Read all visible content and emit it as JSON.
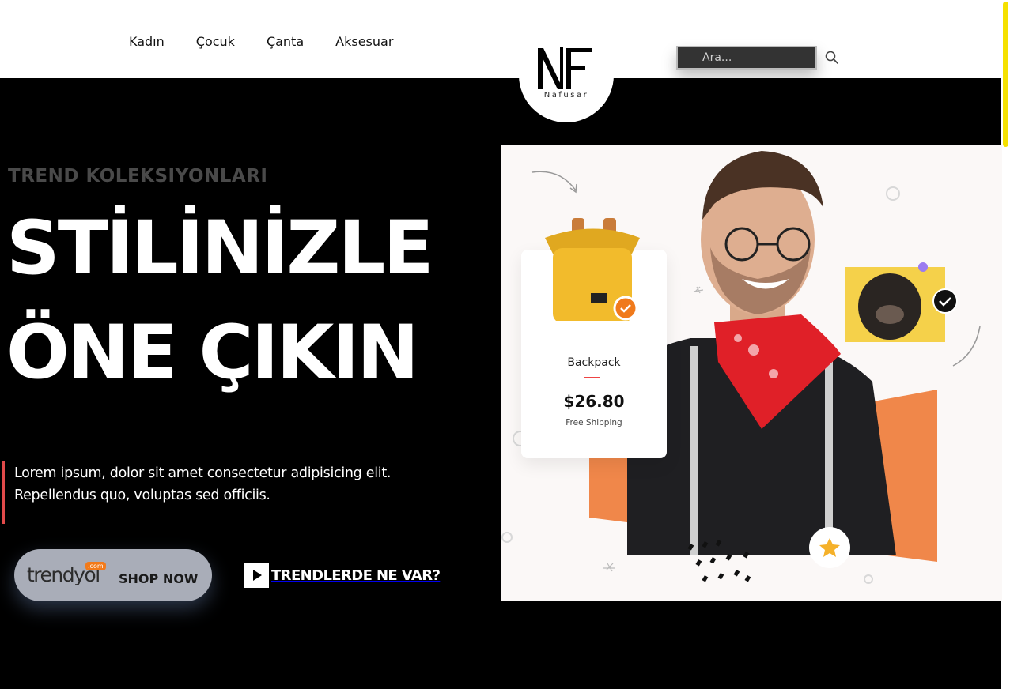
{
  "nav": {
    "items": [
      {
        "label": "Kadın"
      },
      {
        "label": "Çocuk"
      },
      {
        "label": "Çanta"
      },
      {
        "label": "Aksesuar"
      }
    ]
  },
  "logo": {
    "mark": "NF",
    "name": "Nafusar"
  },
  "search": {
    "placeholder": "Ara..."
  },
  "hero": {
    "eyebrow": "TREND KOLEKSIYONLARI",
    "headline_line1": "STİLİNİZLE",
    "headline_line2": "ÖNE ÇIKIN",
    "description": "Lorem ipsum, dolor sit amet consectetur adipisicing elit. Repellendus quo, voluptas sed officiis.",
    "shop_button": {
      "brand": "trendyol",
      "brand_suffix": ".com",
      "label": "SHOP NOW"
    },
    "video_link": "TRENDLERDE NE VAR?"
  },
  "product_card": {
    "name": "Backpack",
    "price": "$26.80",
    "shipping": "Free Shipping"
  },
  "colors": {
    "accent_bar": "#e14a4a",
    "scroll_thumb": "#f5e100",
    "trendyol_orange": "#f27a1a",
    "orange_shape": "#f0874a"
  }
}
